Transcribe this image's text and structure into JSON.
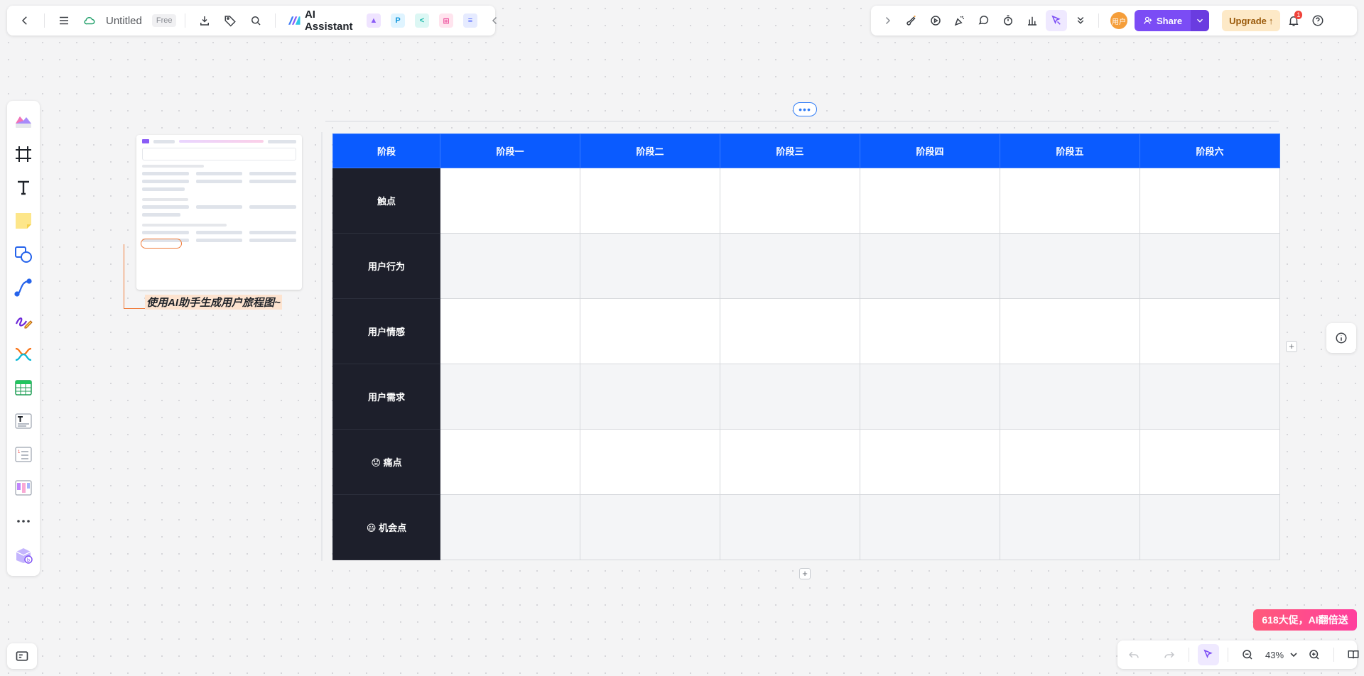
{
  "header": {
    "title": "Untitled",
    "plan_badge": "Free",
    "ai_assistant_label": "AI Assistant",
    "share_label": "Share",
    "upgrade_label": "Upgrade",
    "notification_count": "1",
    "avatar_label": "用户"
  },
  "bottom": {
    "zoom": "43%"
  },
  "promo": {
    "label": "618大促，AI翻倍送"
  },
  "annotation": {
    "text": "使用AI助手生成用户旅程图~"
  },
  "journey": {
    "header_label": "阶段",
    "stages": [
      "阶段一",
      "阶段二",
      "阶段三",
      "阶段四",
      "阶段五",
      "阶段六"
    ],
    "rows": [
      "触点",
      "用户行为",
      "用户情感",
      "用户需求",
      "😟 痛点",
      "😃 机会点"
    ]
  },
  "colors": {
    "accent": "#7b4cf5",
    "table_header": "#0a5bff",
    "row_header": "#1d1f2b",
    "promo": "#ff4f8b"
  }
}
